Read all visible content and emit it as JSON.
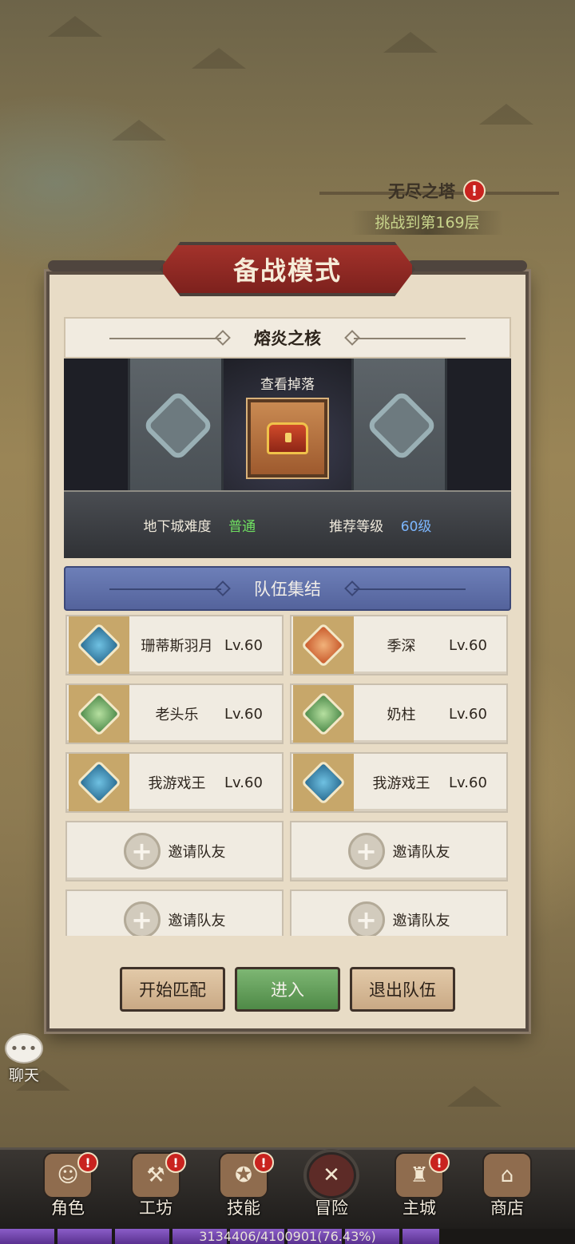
{
  "tower": {
    "title": "无尽之塔",
    "alert": "!",
    "progress": "挑战到第169层"
  },
  "modal": {
    "title": "备战模式",
    "dungeon_name": "熔炎之核",
    "view_drops": "查看掉落",
    "difficulty_label": "地下城难度",
    "difficulty_value": "普通",
    "recommend_label": "推荐等级",
    "recommend_value": "60级",
    "team_header": "队伍集结",
    "slots": [
      {
        "name": "珊蒂斯羽月",
        "level": "Lv.60",
        "icon": "mage-hat-icon"
      },
      {
        "name": "季深",
        "level": "Lv.60",
        "icon": "sword-icon"
      },
      {
        "name": "老头乐",
        "level": "Lv.60",
        "icon": "healer-icon"
      },
      {
        "name": "奶柱",
        "level": "Lv.60",
        "icon": "healer-icon"
      },
      {
        "name": "我游戏王",
        "level": "Lv.60",
        "icon": "mage-hat-icon"
      },
      {
        "name": "我游戏王",
        "level": "Lv.60",
        "icon": "mage-hat-icon"
      }
    ],
    "invite_label": "邀请队友",
    "buttons": {
      "match": "开始匹配",
      "enter": "进入",
      "leave": "退出队伍"
    }
  },
  "chat": {
    "label": "聊天",
    "bubble": "•••"
  },
  "nav": {
    "items": [
      {
        "label": "角色",
        "alert": "!",
        "icon": "character-icon"
      },
      {
        "label": "工坊",
        "alert": "!",
        "icon": "workshop-icon"
      },
      {
        "label": "技能",
        "alert": "!",
        "icon": "skill-book-icon"
      },
      {
        "label": "冒险",
        "alert": "",
        "icon": "crossed-swords-icon"
      },
      {
        "label": "主城",
        "alert": "!",
        "icon": "castle-icon"
      },
      {
        "label": "商店",
        "alert": "",
        "icon": "shop-icon"
      }
    ]
  },
  "exp": {
    "text": "3134406/4100901(76.43%)",
    "fraction": 0.7643
  },
  "colors": {
    "accent_red": "#a3322b",
    "enter_green": "#5f9a56",
    "team_blue": "#6072aa",
    "exp_purple": "#7a4fb8"
  }
}
